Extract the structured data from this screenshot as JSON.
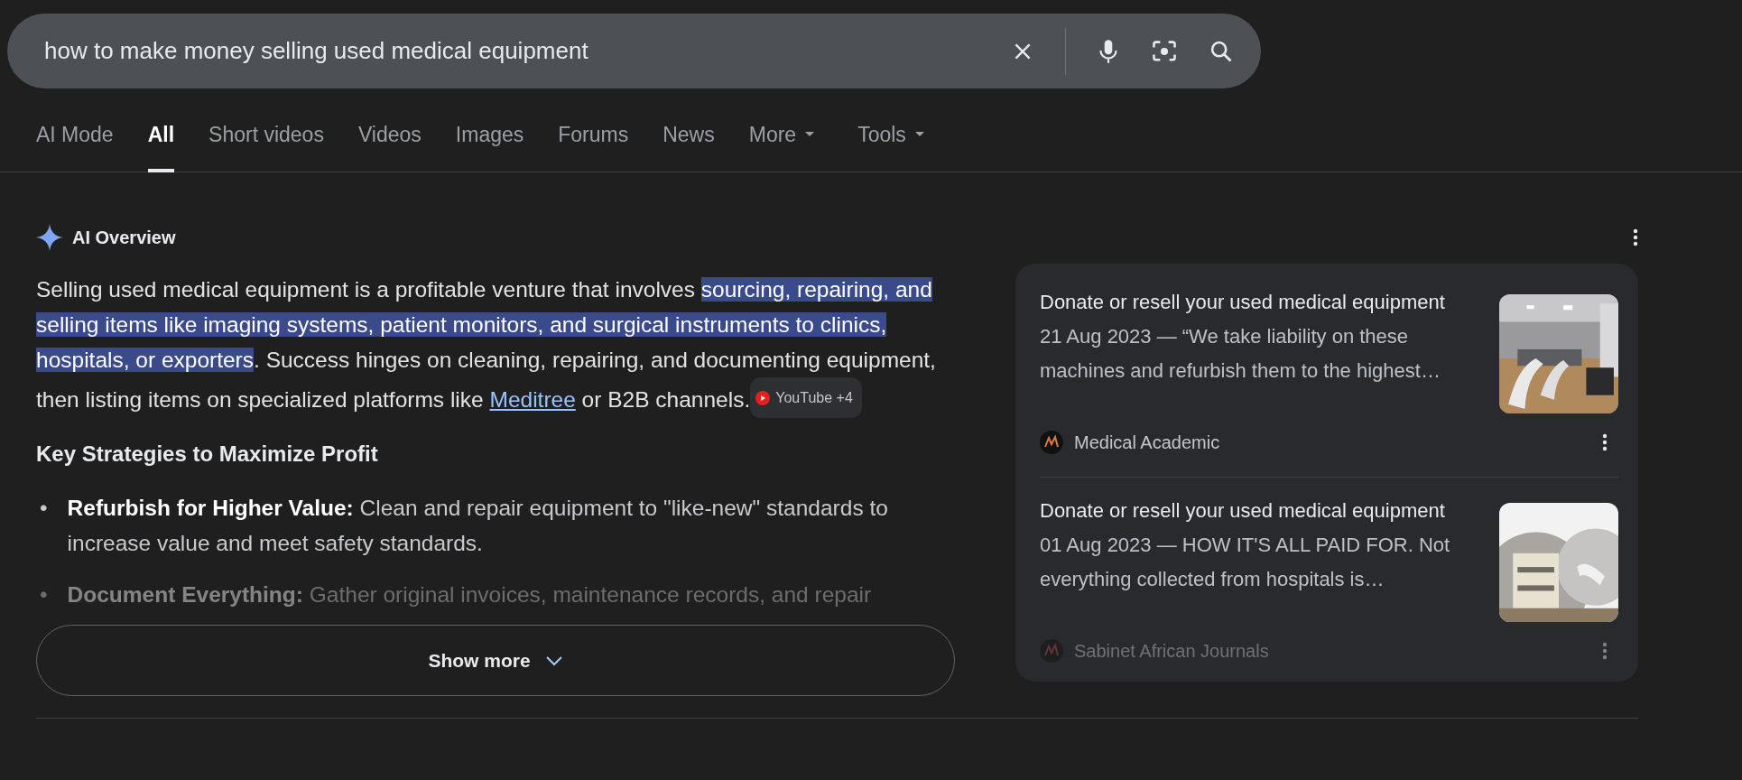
{
  "search": {
    "query": "how to make money selling used medical equipment"
  },
  "tabs": [
    {
      "label": "AI Mode",
      "selected": false,
      "has_menu": false
    },
    {
      "label": "All",
      "selected": true,
      "has_menu": false
    },
    {
      "label": "Short videos",
      "selected": false,
      "has_menu": false
    },
    {
      "label": "Videos",
      "selected": false,
      "has_menu": false
    },
    {
      "label": "Images",
      "selected": false,
      "has_menu": false
    },
    {
      "label": "Forums",
      "selected": false,
      "has_menu": false
    },
    {
      "label": "News",
      "selected": false,
      "has_menu": false
    },
    {
      "label": "More",
      "selected": false,
      "has_menu": true
    },
    {
      "label": "Tools",
      "selected": false,
      "has_menu": true
    }
  ],
  "overview": {
    "title": "AI Overview",
    "paragraph": [
      {
        "kind": "text",
        "text": "Selling used medical equipment is a profitable venture that involves ",
        "highlighted": false
      },
      {
        "kind": "text",
        "text": "sourcing, repairing, and selling items like imaging systems, patient monitors, and surgical instruments to clinics, hospitals, or exporters",
        "highlighted": true
      },
      {
        "kind": "text",
        "text": ". Success hinges on cleaning, repairing, and documenting equipment, then listing items on specialized platforms like ",
        "highlighted": false
      },
      {
        "kind": "link",
        "text": "Meditree"
      },
      {
        "kind": "text",
        "text": " or B2B channels.",
        "highlighted": false
      },
      {
        "kind": "chip",
        "text": "YouTube +4"
      }
    ],
    "heading": "Key Strategies to Maximize Profit",
    "bullets": [
      {
        "marker": "•",
        "text": "**Refurbish for Higher Value:** Clean and repair equipment to \"like-new\" standards to increase value and meet safety standards.",
        "faded": false
      },
      {
        "marker": "•",
        "text": "**Document Everything:** Gather original invoices, maintenance records, and repair",
        "faded": true
      }
    ],
    "show_more": "Show more",
    "results": [
      {
        "title": "Donate or resell your used medical equipment",
        "snippet": "21 Aug 2023 — “We take liability on these machines and refurbish them to the highest…",
        "source": "Medical Academic",
        "source_faded": false
      },
      {
        "title": "Donate or resell your used medical equipment",
        "snippet": "01 Aug 2023 — HOW IT'S ALL PAID FOR. Not everything collected from hospitals is…",
        "source": "Sabinet African Journals",
        "source_faded": true
      }
    ]
  }
}
